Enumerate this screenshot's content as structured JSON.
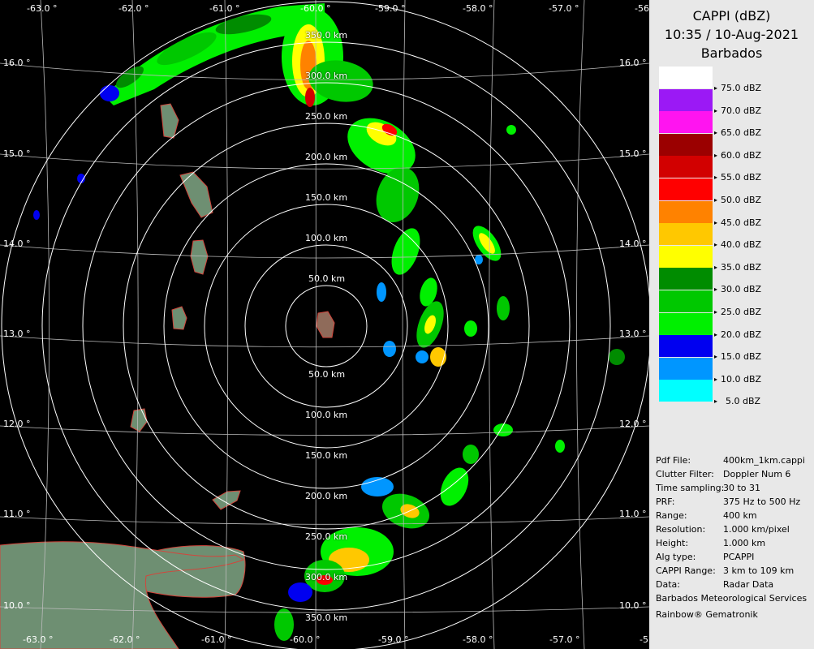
{
  "title": {
    "line1": "CAPPI (dBZ)",
    "line2": "10:35 / 10-Aug-2021",
    "line3": "Barbados"
  },
  "colors": {
    "background": "#000000",
    "rings": "#ffffff",
    "land": "#6e8f72",
    "coast": "#d2463c",
    "panel": "#e8e8e8"
  },
  "legend": [
    {
      "label": "75.0 dBZ",
      "color": "#ffffff"
    },
    {
      "label": "70.0 dBZ",
      "color": "#9b19f5"
    },
    {
      "label": "65.0 dBZ",
      "color": "#ff14f0"
    },
    {
      "label": "60.0 dBZ",
      "color": "#9b0000"
    },
    {
      "label": "55.0 dBZ",
      "color": "#d20000"
    },
    {
      "label": "50.0 dBZ",
      "color": "#ff0000"
    },
    {
      "label": "45.0 dBZ",
      "color": "#ff8200"
    },
    {
      "label": "40.0 dBZ",
      "color": "#ffc800"
    },
    {
      "label": "35.0 dBZ",
      "color": "#ffff00"
    },
    {
      "label": "30.0 dBZ",
      "color": "#008c00"
    },
    {
      "label": "25.0 dBZ",
      "color": "#00c800"
    },
    {
      "label": "20.0 dBZ",
      "color": "#00f000"
    },
    {
      "label": "15.0 dBZ",
      "color": "#0000f0"
    },
    {
      "label": "10.0 dBZ",
      "color": "#0096ff"
    },
    {
      "label": "5.0 dBZ",
      "color": "#00ffff"
    }
  ],
  "lon_labels_top": [
    "-63.0 °",
    "-62.0 °",
    "-61.0 °",
    "-60.0 °",
    "-59.0 °",
    "-58.0 °",
    "-57.0 °",
    "-56"
  ],
  "lon_labels_bottom": [
    "-63.0 °",
    "-62.0 °",
    "-61.0 °",
    "-60.0 °",
    "-59.0 °",
    "-58.0 °",
    "-57.0 °",
    "-5"
  ],
  "lat_labels": [
    "16.0 °",
    "15.0 °",
    "14.0 °",
    "13.0 °",
    "12.0 °",
    "11.0 °",
    "10.0 °"
  ],
  "ring_labels_north": [
    "50.0 km",
    "100.0 km",
    "150.0 km",
    "200.0 km",
    "250.0 km",
    "300.0 km",
    "350.0 km"
  ],
  "ring_labels_south": [
    "50.0 km",
    "100.0 km",
    "150.0 km",
    "200.0 km",
    "250.0 km",
    "300.0 km",
    "350.0 km"
  ],
  "info": [
    {
      "key": "Pdf File:",
      "value": "400km_1km.cappi"
    },
    {
      "key": "Clutter Filter:",
      "value": "Doppler Num 6"
    },
    {
      "key": "Time sampling:",
      "value": "30 to 31"
    },
    {
      "key": "PRF:",
      "value": "375 Hz to 500 Hz"
    },
    {
      "key": "Range:",
      "value": "400 km"
    },
    {
      "key": "Resolution:",
      "value": "1.000 km/pixel"
    },
    {
      "key": "Height:",
      "value": "1.000 km"
    },
    {
      "key": "Alg type:",
      "value": "PCAPPI"
    },
    {
      "key": "CAPPI Range:",
      "value": "3 km to 109 km"
    },
    {
      "key": "Data:",
      "value": "Radar Data"
    }
  ],
  "footer": [
    "Barbados Meteorological Services",
    "Rainbow® Gematronik"
  ]
}
